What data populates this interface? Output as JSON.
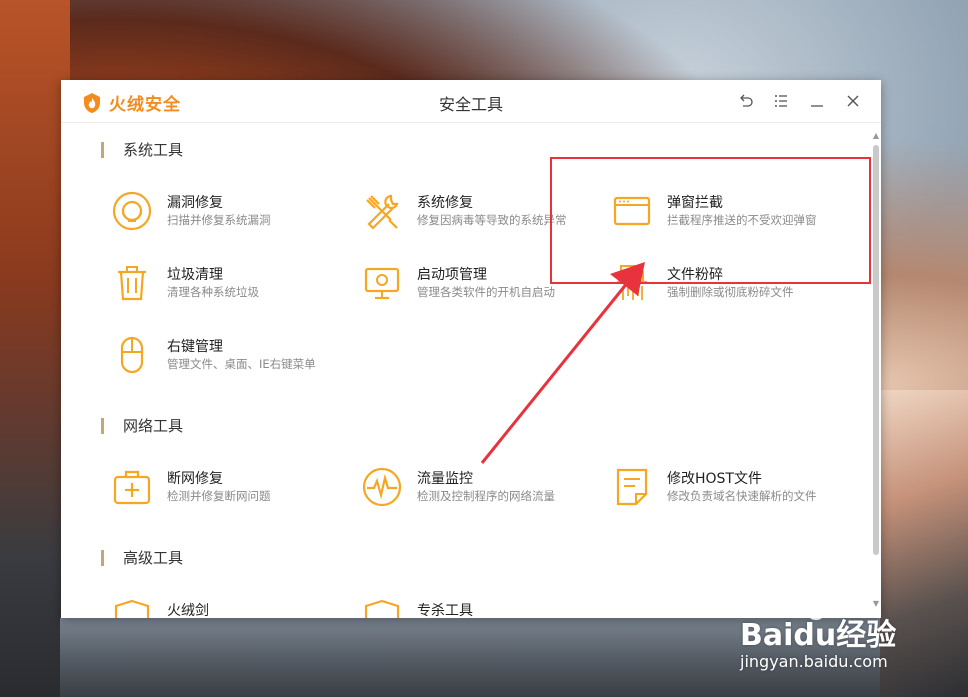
{
  "app": {
    "logo_text": "火绒安全",
    "window_title": "安全工具"
  },
  "colors": {
    "accent": "#f5a623",
    "brand": "#f28c1f",
    "highlight": "#e8323c",
    "section_bar": "#c8a47a"
  },
  "sections": {
    "system": {
      "title": "系统工具",
      "tools": [
        {
          "name": "漏洞修复",
          "desc": "扫描并修复系统漏洞",
          "icon": "vulnerability-fix-icon"
        },
        {
          "name": "系统修复",
          "desc": "修复因病毒等导致的系统异常",
          "icon": "system-repair-icon"
        },
        {
          "name": "弹窗拦截",
          "desc": "拦截程序推送的不受欢迎弹窗",
          "icon": "popup-block-icon"
        },
        {
          "name": "垃圾清理",
          "desc": "清理各种系统垃圾",
          "icon": "trash-clean-icon"
        },
        {
          "name": "启动项管理",
          "desc": "管理各类软件的开机自启动",
          "icon": "startup-manager-icon"
        },
        {
          "name": "文件粉碎",
          "desc": "强制删除或彻底粉碎文件",
          "icon": "file-shredder-icon"
        },
        {
          "name": "右键管理",
          "desc": "管理文件、桌面、IE右键菜单",
          "icon": "right-click-manager-icon"
        }
      ]
    },
    "network": {
      "title": "网络工具",
      "tools": [
        {
          "name": "断网修复",
          "desc": "检测并修复断网问题",
          "icon": "network-repair-icon"
        },
        {
          "name": "流量监控",
          "desc": "检测及控制程序的网络流量",
          "icon": "traffic-monitor-icon"
        },
        {
          "name": "修改HOST文件",
          "desc": "修改负责域名快速解析的文件",
          "icon": "host-file-icon"
        }
      ]
    },
    "advanced": {
      "title": "高级工具",
      "tools": [
        {
          "name": "火绒剑",
          "icon": "hr-sword-icon"
        },
        {
          "name": "专杀工具",
          "icon": "dedicated-kill-icon"
        }
      ]
    }
  },
  "watermark": {
    "main": "Baidu经验",
    "sub": "jingyan.baidu.com"
  }
}
